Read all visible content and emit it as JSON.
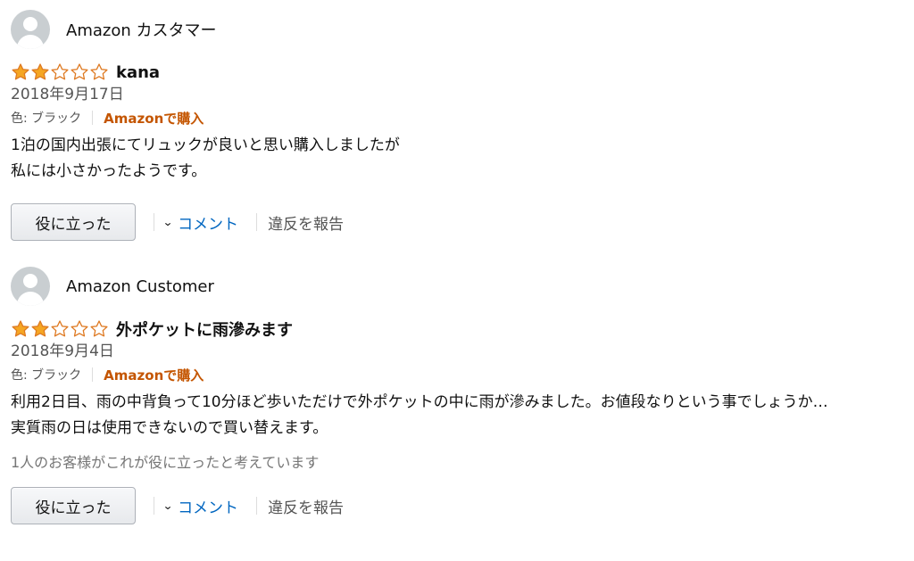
{
  "reviews": [
    {
      "reviewer": "Amazon カスタマー",
      "rating": 2,
      "max_rating": 5,
      "title": "kana",
      "date": "2018年9月17日",
      "variant": "色: ブラック",
      "verified": "Amazonで購入",
      "body_lines": [
        "1泊の国内出張にてリュックが良いと思い購入しましたが",
        "私には小さかったようです。"
      ],
      "helpful_count_text": "",
      "helpful_label": "役に立った",
      "comment_label": "コメント",
      "report_label": "違反を報告"
    },
    {
      "reviewer": "Amazon Customer",
      "rating": 2,
      "max_rating": 5,
      "title": "外ポケットに雨滲みます",
      "date": "2018年9月4日",
      "variant": "色: ブラック",
      "verified": "Amazonで購入",
      "body_lines": [
        "利用2日目、雨の中背負って10分ほど歩いただけで外ポケットの中に雨が滲みました。お値段なりという事でしょうか…",
        "実質雨の日は使用できないので買い替えます。"
      ],
      "helpful_count_text": "1人のお客様がこれが役に立ったと考えています",
      "helpful_label": "役に立った",
      "comment_label": "コメント",
      "report_label": "違反を報告"
    }
  ],
  "colors": {
    "star_fill": "#f5a623",
    "star_outline": "#de7921",
    "verified": "#c45500",
    "link": "#0066c0"
  },
  "icons": {
    "avatar": "default-avatar-icon",
    "star_filled": "star-filled-icon",
    "star_empty": "star-empty-icon",
    "chevron": "chevron-down-icon"
  }
}
